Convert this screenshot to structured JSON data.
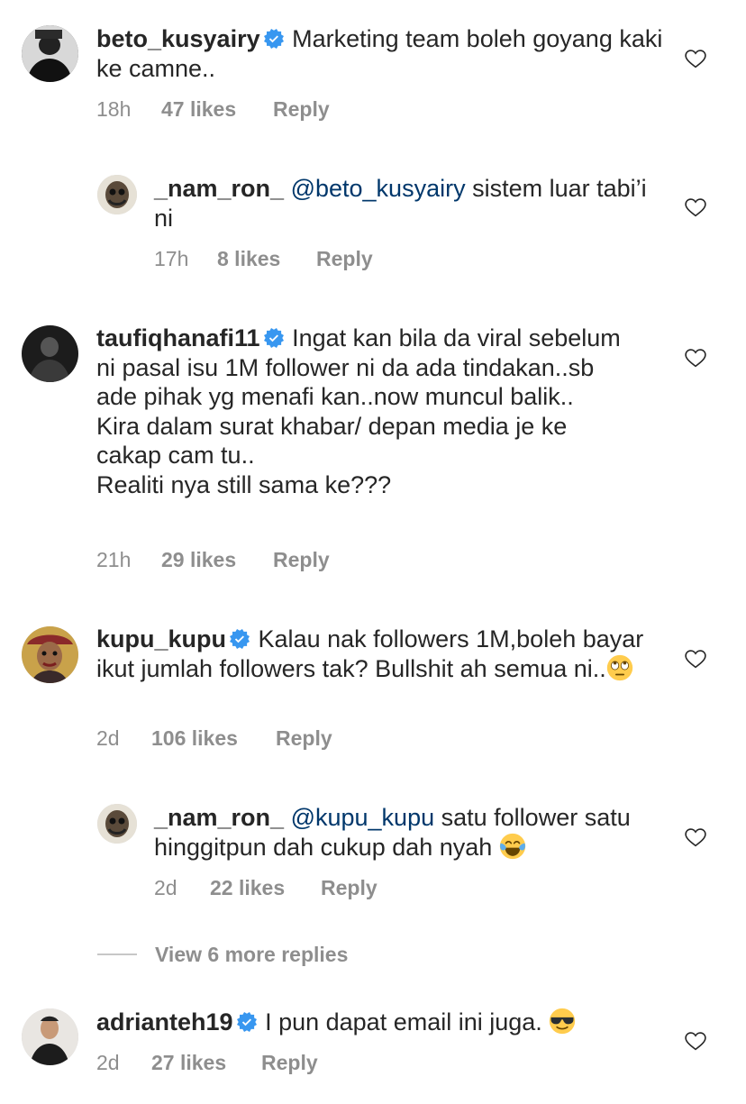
{
  "comments": [
    {
      "username": "beto_kusyairy",
      "verified": true,
      "mention": "",
      "text": "Marketing team boleh goyang kaki ke camne..",
      "time": "18h",
      "likes": "47 likes",
      "reply": "Reply"
    },
    {
      "username": "_nam_ron_",
      "verified": false,
      "mention": "@beto_kusyairy",
      "text": "sistem luar tabi’i ni",
      "time": "17h",
      "likes": "8 likes",
      "reply": "Reply"
    },
    {
      "username": "taufiqhanafi11",
      "verified": true,
      "mention": "",
      "text": "Ingat kan bila da viral sebelum ni pasal isu 1M follower ni da ada tindakan..sb ade pihak yg menafi kan..now muncul balik..\nKira dalam surat khabar/ depan media je ke cakap cam tu..\nRealiti nya still sama ke???",
      "time": "21h",
      "likes": "29 likes",
      "reply": "Reply"
    },
    {
      "username": "kupu_kupu",
      "verified": true,
      "mention": "",
      "text": "Kalau nak followers 1M,boleh bayar ikut jumlah followers tak? Bullshit ah semua ni..",
      "emoji": "face-with-rolling-eyes",
      "time": "2d",
      "likes": "106 likes",
      "reply": "Reply"
    },
    {
      "username": "_nam_ron_",
      "verified": false,
      "mention": "@kupu_kupu",
      "text": "satu follower satu hinggitpun dah cukup dah nyah",
      "emoji": "face-with-tears-of-joy",
      "time": "2d",
      "likes": "22 likes",
      "reply": "Reply"
    },
    {
      "username": "adrianteh19",
      "verified": true,
      "mention": "",
      "text": "I pun dapat email ini juga.",
      "emoji": "smiling-face-with-sunglasses",
      "time": "2d",
      "likes": "27 likes",
      "reply": "Reply"
    }
  ],
  "view_more": "View 6 more replies",
  "colors": {
    "text": "#262626",
    "secondary": "#8e8e8e",
    "mention": "#00376b",
    "verified": "#3897f0"
  },
  "icons": {
    "like": "heart-outline-icon",
    "verified": "verified-badge-icon"
  }
}
